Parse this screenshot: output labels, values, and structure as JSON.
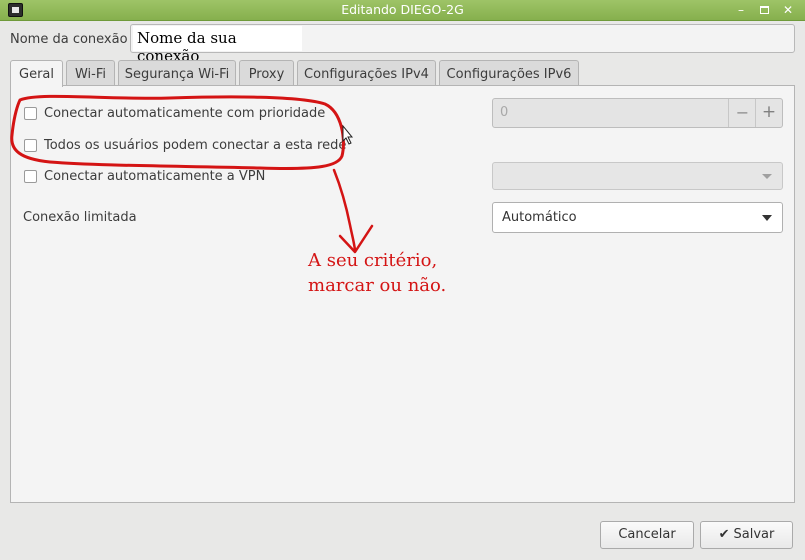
{
  "window": {
    "title": "Editando DIEGO-2G",
    "minimize_glyph": "–",
    "close_glyph": "✕"
  },
  "connection": {
    "name_label": "Nome da conexão",
    "name_value": "Nome da sua conexão"
  },
  "tabs": [
    {
      "label": "Geral",
      "active": true
    },
    {
      "label": "Wi-Fi"
    },
    {
      "label": "Segurança Wi-Fi"
    },
    {
      "label": "Proxy"
    },
    {
      "label": "Configurações IPv4"
    },
    {
      "label": "Configurações IPv6"
    }
  ],
  "general": {
    "auto_connect_label": "Conectar automaticamente com prioridade",
    "priority_value": "0",
    "minus_glyph": "−",
    "plus_glyph": "+",
    "all_users_label": "Todos os usuários podem conectar a esta rede",
    "auto_vpn_label": "Conectar automaticamente a VPN",
    "metered_label": "Conexão limitada",
    "metered_value": "Automático"
  },
  "annotation": {
    "line1": "A seu critério,",
    "line2": "marcar ou não.",
    "color": "#d41414"
  },
  "buttons": {
    "cancel": "Cancelar",
    "save": "Salvar",
    "save_icon": "✔"
  }
}
